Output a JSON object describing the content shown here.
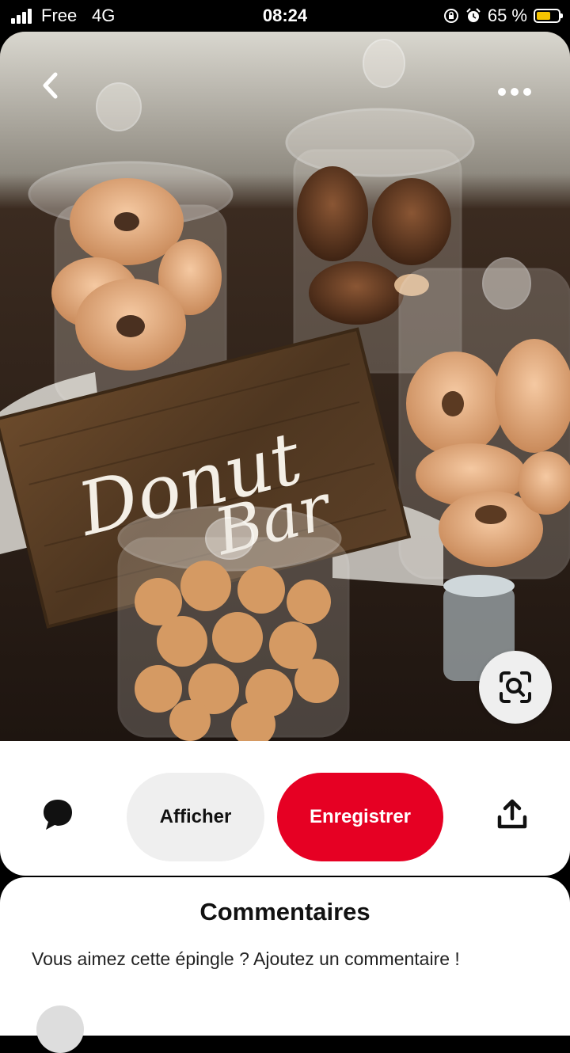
{
  "status_bar": {
    "carrier": "Free",
    "network": "4G",
    "time": "08:24",
    "battery_percent": "65 %",
    "battery_level": 0.65,
    "icons": [
      "signal-icon",
      "lock-rotation-icon",
      "alarm-icon",
      "battery-icon"
    ]
  },
  "pin": {
    "image_sign_text": [
      "Donut",
      "Bar"
    ],
    "icons": [
      "back-arrow-icon",
      "more-dots-icon",
      "visual-search-icon"
    ]
  },
  "actions": {
    "view_label": "Afficher",
    "save_label": "Enregistrer",
    "icons": [
      "comment-bubble-icon",
      "share-icon"
    ]
  },
  "comments": {
    "title": "Commentaires",
    "prompt": "Vous aimez cette épingle ? Ajoutez un commentaire !"
  },
  "colors": {
    "save_button": "#e60023",
    "neutral_button": "#efefef",
    "battery_fill": "#f5c400"
  }
}
